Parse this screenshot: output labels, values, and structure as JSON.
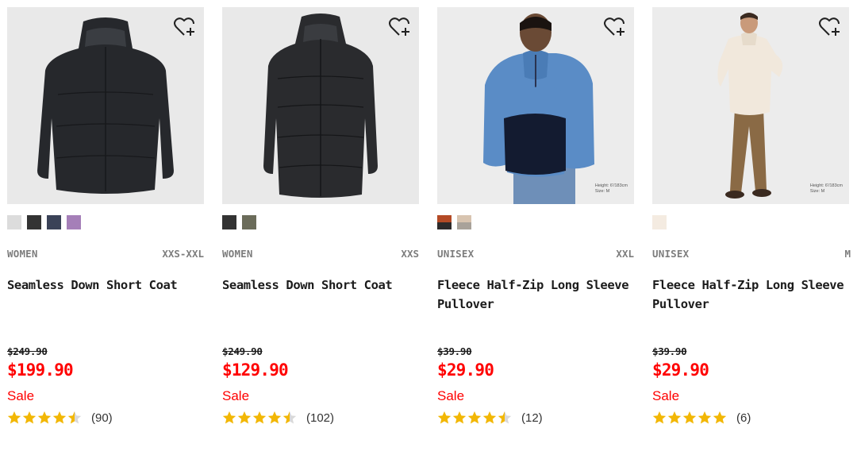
{
  "products": [
    {
      "gender": "WOMEN",
      "size": "XXS-XXL",
      "name": "Seamless Down Short Coat",
      "original_price": "$249.90",
      "price": "$199.90",
      "sale_label": "Sale",
      "rating": 4.5,
      "review_count": "(90)",
      "swatches": [
        "#dcdcdc",
        "#333333",
        "#3a4257",
        "#a57fb8"
      ],
      "image": "black hooded down coat on grey background",
      "favorite_icon": "heart-plus-icon"
    },
    {
      "gender": "WOMEN",
      "size": "XXS",
      "name": "Seamless Down Short Coat",
      "original_price": "$249.90",
      "price": "$129.90",
      "sale_label": "Sale",
      "rating": 4.5,
      "review_count": "(102)",
      "swatches": [
        "#333333",
        "#6b6c5a"
      ],
      "image": "black long hooded down coat on grey background",
      "favorite_icon": "heart-plus-icon"
    },
    {
      "gender": "UNISEX",
      "size": "XXL",
      "name": "Fleece Half-Zip Long Sleeve Pullover",
      "original_price": "$39.90",
      "price": "$29.90",
      "sale_label": "Sale",
      "rating": 4.5,
      "review_count": "(12)",
      "swatches": [
        [
          "#b44a25",
          "#2e2a2a"
        ],
        [
          "#d8c4b0",
          "#a9a29a"
        ]
      ],
      "image": "model wearing blue and navy fleece half-zip pullover",
      "model_info": [
        "Height: 6'/183cm",
        "Size: M"
      ],
      "favorite_icon": "heart-plus-icon"
    },
    {
      "gender": "UNISEX",
      "size": "M",
      "name": "Fleece Half-Zip Long Sleeve Pullover",
      "original_price": "$39.90",
      "price": "$29.90",
      "sale_label": "Sale",
      "rating": 5,
      "review_count": "(6)",
      "swatches": [
        "#f4ebe1"
      ],
      "image": "model wearing cream fleece half-zip pullover with brown trousers",
      "model_info": [
        "Height: 6'/183cm",
        "Size: M"
      ],
      "favorite_icon": "heart-plus-icon"
    }
  ],
  "colors": {
    "sale_red": "#ff0000",
    "star_gold": "#f2b705",
    "image_bg": "#e9e9e9"
  }
}
